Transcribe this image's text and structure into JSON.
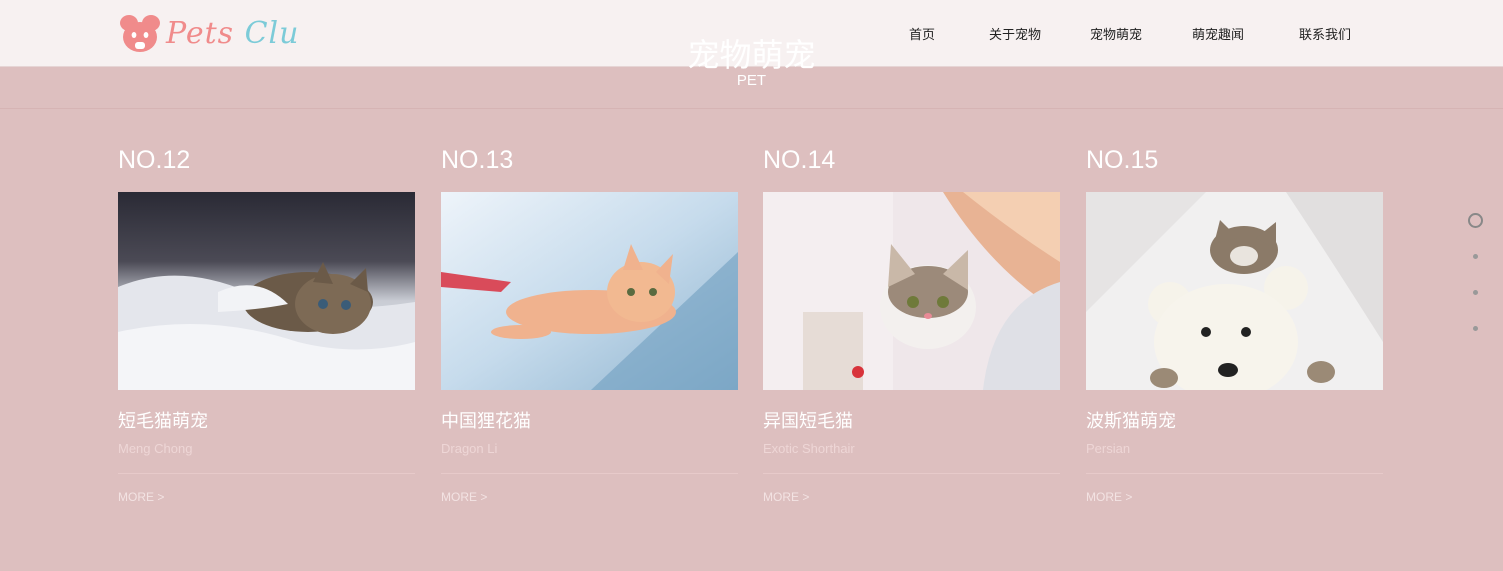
{
  "brand": {
    "logo_part1": "Pets ",
    "logo_part2": "Clu"
  },
  "nav": [
    {
      "label": "首页"
    },
    {
      "label": "关于宠物"
    },
    {
      "label": "宠物萌宠"
    },
    {
      "label": "萌宠趣闻"
    },
    {
      "label": "联系我们"
    }
  ],
  "hero": {
    "title": "宠物萌宠",
    "subtitle": "PET"
  },
  "cards": [
    {
      "no": "NO.12",
      "title": "短毛猫萌宠",
      "en": "Meng Chong",
      "more": "MORE >",
      "image": "kitten-on-white-bed-photo"
    },
    {
      "no": "NO.13",
      "title": "中国狸花猫",
      "en": "Dragon Li",
      "more": "MORE >",
      "image": "orange-cat-on-windshield-photo"
    },
    {
      "no": "NO.14",
      "title": "异国短毛猫",
      "en": "Exotic Shorthair",
      "more": "MORE >",
      "image": "white-tabby-cat-by-curtain-photo"
    },
    {
      "no": "NO.15",
      "title": "波斯猫萌宠",
      "en": "Persian",
      "more": "MORE >",
      "image": "cat-sleeping-with-teddy-bear-photo"
    }
  ],
  "pager": {
    "total": 4,
    "active": 1
  },
  "colors": {
    "background": "#ddbfbf",
    "header": "#f7f1f1",
    "logo_pink": "#f08b8b",
    "logo_blue": "#7ccbd8"
  }
}
